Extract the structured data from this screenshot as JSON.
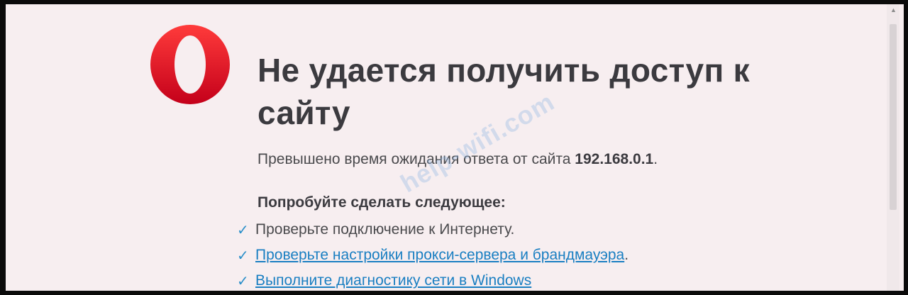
{
  "page": {
    "title": "Не удается получить доступ к сайту",
    "error_prefix": "Превышено время ожидания ответа от сайта ",
    "error_host": "192.168.0.1",
    "error_suffix": ".",
    "suggest_heading": "Попробуйте сделать следующее:",
    "suggestions": [
      {
        "text": "Проверьте подключение к Интернету.",
        "is_link": false
      },
      {
        "text": "Проверьте настройки прокси-сервера и брандмауэра",
        "is_link": true,
        "tail": "."
      },
      {
        "text": "Выполните диагностику сети в Windows",
        "is_link": true,
        "tail": ""
      }
    ]
  },
  "watermark": "help-wifi.com",
  "icons": {
    "logo": "opera-logo-icon",
    "check": "check-icon"
  },
  "colors": {
    "logo_red": "#e0142a",
    "link": "#1a7fc2",
    "check": "#2a8fc9",
    "background": "#f7eef0"
  }
}
